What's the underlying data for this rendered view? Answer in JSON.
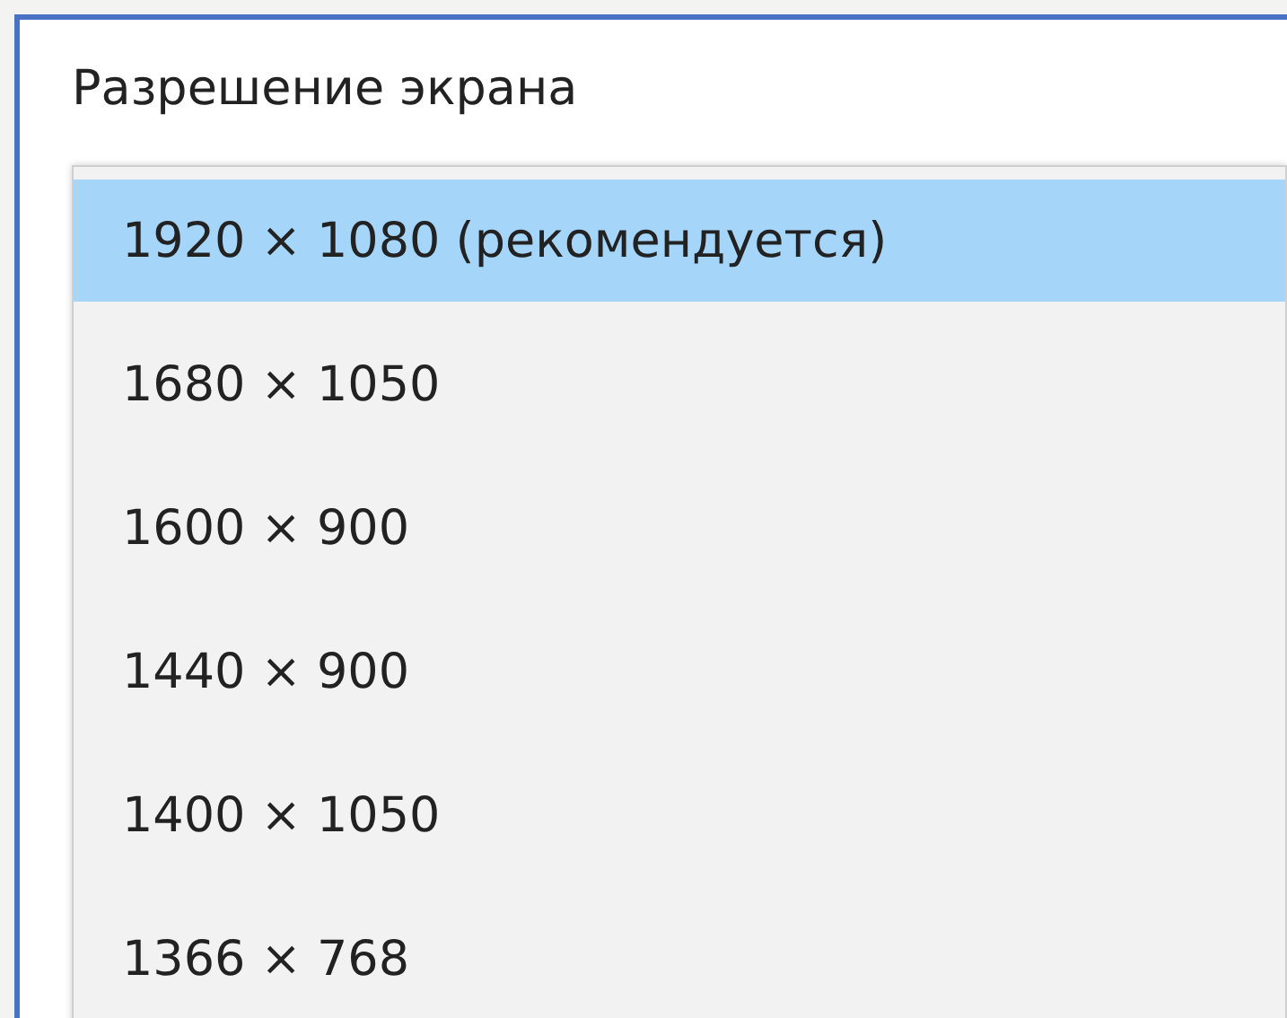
{
  "label": "Разрешение экрана",
  "options": [
    {
      "text": "1920 × 1080 (рекомендуется)",
      "selected": true
    },
    {
      "text": "1680 × 1050",
      "selected": false
    },
    {
      "text": "1600 × 900",
      "selected": false
    },
    {
      "text": "1440 × 900",
      "selected": false
    },
    {
      "text": "1400 × 1050",
      "selected": false
    },
    {
      "text": "1366 × 768",
      "selected": false
    }
  ]
}
